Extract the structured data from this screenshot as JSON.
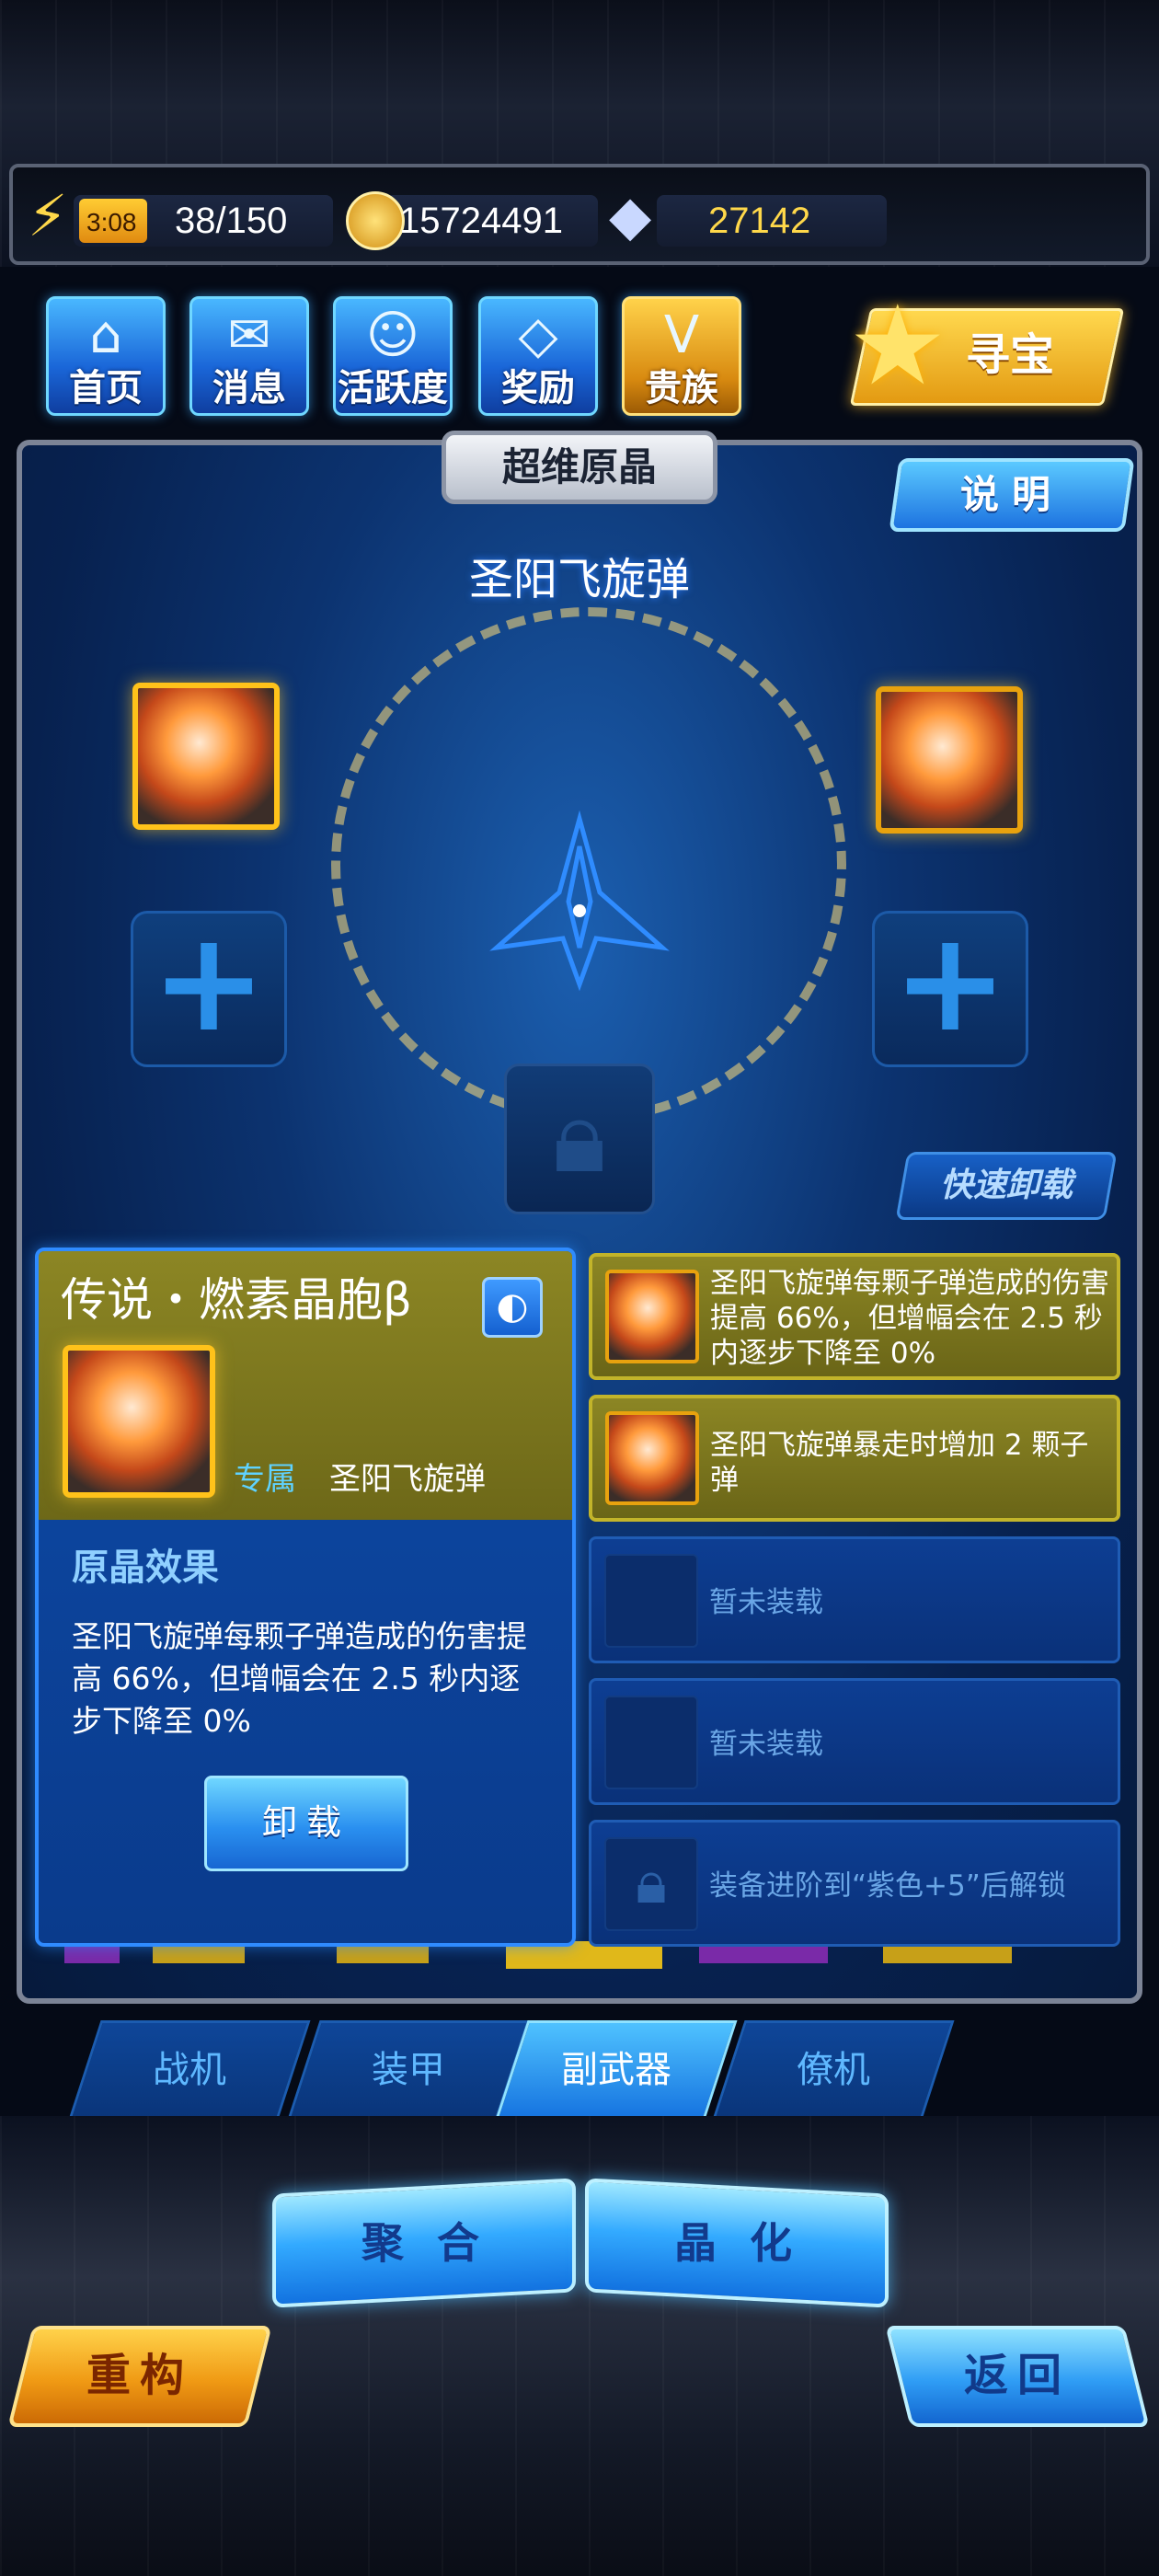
{
  "resources": {
    "energy_timer": "3:08",
    "energy": "38/150",
    "gold": "15724491",
    "diamonds": "27142"
  },
  "nav": {
    "items": [
      {
        "label": "首页",
        "icon": "home-icon"
      },
      {
        "label": "消息",
        "icon": "message-icon"
      },
      {
        "label": "活跃度",
        "icon": "activity-icon"
      },
      {
        "label": "奖励",
        "icon": "gift-icon"
      },
      {
        "label": "贵族",
        "icon": "noble-icon"
      }
    ],
    "treasure_label": "寻宝"
  },
  "panel": {
    "title": "超维原晶",
    "info_label": "说明",
    "weapon_name": "圣阳飞旋弹",
    "quick_unload_label": "快速卸载"
  },
  "detail": {
    "title": "传说・燃素晶胞β",
    "exclusive_tag": "专属",
    "weapon_tag": "圣阳飞旋弹",
    "effect_heading": "原晶效果",
    "effect_text": "圣阳飞旋弹每颗子弹造成的伤害提高 66%，但增幅会在 2.5 秒内逐步下降至 0%",
    "unload_label": "卸载"
  },
  "effects": [
    {
      "text": "圣阳飞旋弹每颗子弹造成的伤害提高 66%，但增幅会在 2.5 秒内逐步下降至 0%",
      "state": "equipped"
    },
    {
      "text": "圣阳飞旋弹暴走时增加 2 颗子弹",
      "state": "equipped"
    },
    {
      "text": "暂未装载",
      "state": "empty"
    },
    {
      "text": "暂未装载",
      "state": "empty"
    },
    {
      "text": "装备进阶到“紫色+5”后解锁",
      "state": "locked"
    }
  ],
  "tabs": [
    {
      "label": "战机",
      "active": false
    },
    {
      "label": "装甲",
      "active": false
    },
    {
      "label": "副武器",
      "active": true
    },
    {
      "label": "僚机",
      "active": false
    }
  ],
  "actions": {
    "fuse_label": "聚合",
    "crystallize_label": "晶化",
    "rebuild_label": "重构",
    "back_label": "返回"
  },
  "colors": {
    "accent_blue": "#1d73e0",
    "gold": "#ffc21a",
    "panel_bg": "#0c3370"
  }
}
